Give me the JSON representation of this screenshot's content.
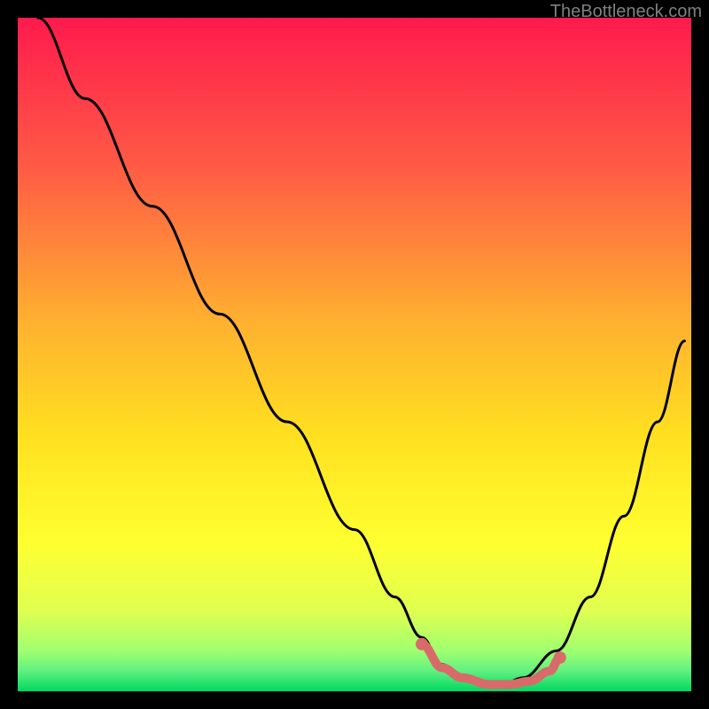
{
  "watermark": "TheBottleneck.com",
  "chart_data": {
    "type": "line",
    "title": "",
    "xlabel": "",
    "ylabel": "",
    "xlim": [
      0,
      100
    ],
    "ylim": [
      0,
      100
    ],
    "background_gradient": {
      "top": "#ff1a4d",
      "mid_upper": "#ff8040",
      "mid": "#ffd820",
      "mid_lower": "#ffff20",
      "lower": "#d8ff60",
      "bottom_approach": "#80ff80",
      "bottom": "#00e060"
    },
    "series": [
      {
        "name": "bottleneck-curve",
        "color": "#000000",
        "x": [
          3,
          10,
          20,
          30,
          40,
          50,
          56,
          60,
          63,
          66,
          70,
          72,
          75,
          80,
          85,
          90,
          95,
          99
        ],
        "y": [
          100,
          88,
          72,
          56,
          40,
          24,
          14,
          8,
          4,
          2,
          1,
          1,
          2,
          6,
          14,
          26,
          40,
          52
        ]
      }
    ],
    "highlight_segment": {
      "name": "optimal-range",
      "color": "#d96a6a",
      "x": [
        60,
        63,
        66,
        70,
        73,
        76,
        79,
        80.5
      ],
      "y": [
        7,
        3.5,
        2,
        1,
        1,
        1.5,
        3,
        5
      ],
      "endpoints": [
        {
          "x": 60,
          "y": 7
        },
        {
          "x": 80.5,
          "y": 5
        }
      ]
    }
  }
}
